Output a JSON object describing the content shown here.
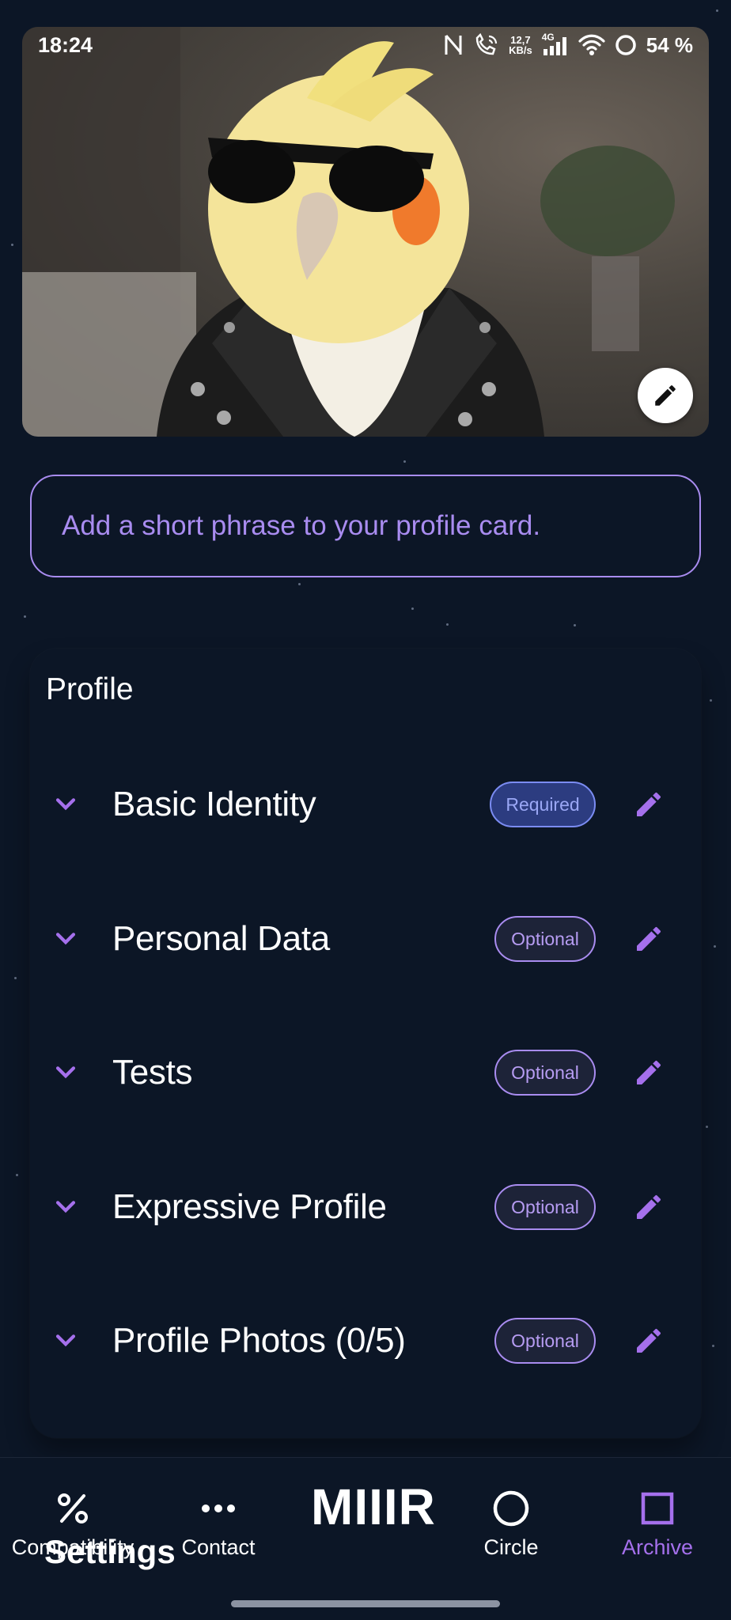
{
  "status_bar": {
    "time": "18:24",
    "network_speed_value": "12,7",
    "network_speed_unit": "KB/s",
    "cell_type": "4G",
    "battery": "54 %",
    "icons": [
      "nfc-icon",
      "volte-call-icon",
      "signal-icon",
      "wifi-icon",
      "battery-ring-icon"
    ]
  },
  "hero": {
    "edit_icon": "pencil-icon"
  },
  "phrase_input": {
    "placeholder": "Add a short phrase to your profile card."
  },
  "profile": {
    "title": "Profile",
    "sections": [
      {
        "label": "Basic Identity",
        "badge": "Required",
        "badge_type": "required"
      },
      {
        "label": "Personal Data",
        "badge": "Optional",
        "badge_type": "optional"
      },
      {
        "label": "Tests",
        "badge": "Optional",
        "badge_type": "optional"
      },
      {
        "label": "Expressive Profile",
        "badge": "Optional",
        "badge_type": "optional"
      },
      {
        "label": "Profile Photos (0/5)",
        "badge": "Optional",
        "badge_type": "optional"
      }
    ]
  },
  "bottom_nav": {
    "brand": "MIIIR",
    "overlay_label": "Settings",
    "items": [
      {
        "label": "Compatibility",
        "icon": "percent-icon",
        "active": false
      },
      {
        "label": "Contact",
        "icon": "dots-icon",
        "active": false
      },
      {
        "label": "Circle",
        "icon": "circle-icon",
        "active": false
      },
      {
        "label": "Archive",
        "icon": "square-icon",
        "active": true
      }
    ]
  },
  "colors": {
    "background": "#0c1626",
    "accent": "#a98cf0",
    "active_nav": "#a570ec",
    "required_badge": "#2c3c80"
  }
}
